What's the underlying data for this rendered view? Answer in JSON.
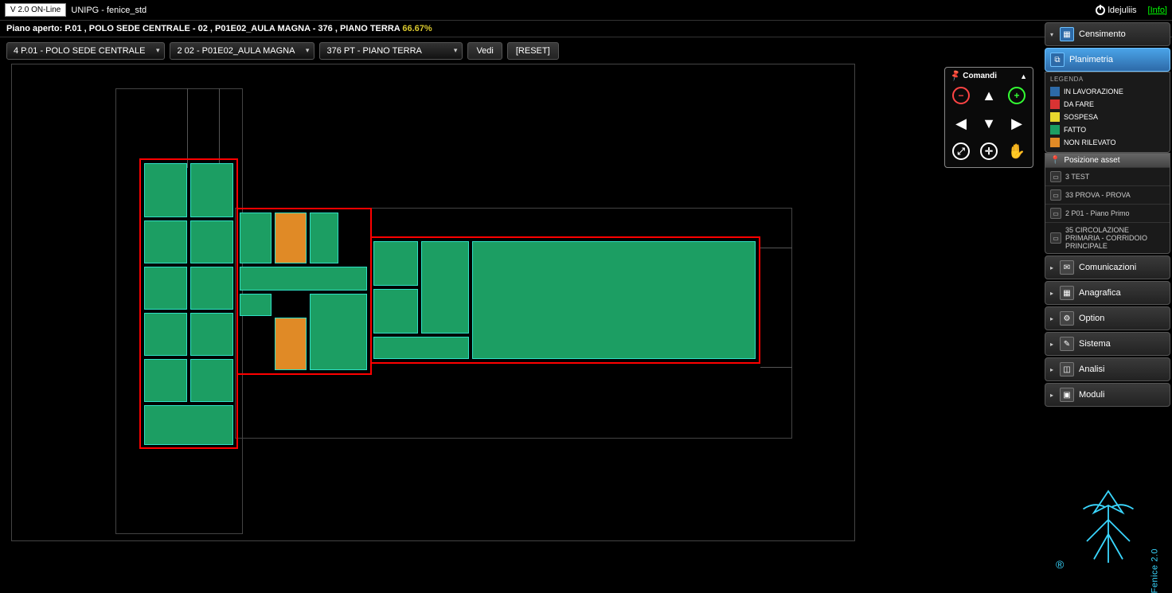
{
  "topbar": {
    "version": "V 2.0 ON-Line",
    "app_title": "UNIPG - fenice_std",
    "user": "ldejuliis",
    "info_link": "[Info]"
  },
  "subheader": {
    "label": "Piano aperto:",
    "path": "P.01 , POLO SEDE CENTRALE - 02 , P01E02_AULA MAGNA - 376 , PIANO TERRA",
    "percent": "66.67%"
  },
  "toolbar": {
    "dd1": "4 P.01 - POLO SEDE CENTRALE",
    "dd2": "2 02 - P01E02_AULA MAGNA",
    "dd3": "376 PT - PIANO TERRA",
    "btn_view": "Vedi",
    "btn_reset": "[RESET]"
  },
  "commands": {
    "header": "Comandi"
  },
  "sidebar": {
    "items": [
      {
        "label": "Censimento"
      },
      {
        "label": "Planimetria"
      },
      {
        "label": "Comunicazioni"
      },
      {
        "label": "Anagrafica"
      },
      {
        "label": "Option"
      },
      {
        "label": "Sistema"
      },
      {
        "label": "Analisi"
      },
      {
        "label": "Moduli"
      }
    ],
    "legend": {
      "title": "LEGENDA",
      "rows": [
        {
          "label": "IN LAVORAZIONE",
          "color": "#2d6aa8"
        },
        {
          "label": "DA FARE",
          "color": "#d93333"
        },
        {
          "label": "SOSPESA",
          "color": "#e8d82e"
        },
        {
          "label": "FATTO",
          "color": "#1c9e63"
        },
        {
          "label": "NON RILEVATO",
          "color": "#e08a26"
        }
      ]
    },
    "assets": {
      "header": "Posizione asset",
      "rows": [
        {
          "label": "3 TEST"
        },
        {
          "label": "33 PROVA - PROVA"
        },
        {
          "label": "2 P01 - Piano Primo"
        },
        {
          "label": "35 CIRCOLAZIONE PRIMARIA - CORRIDOIO PRINCIPALE"
        }
      ]
    }
  },
  "logo": {
    "name": "Fenice 2.0",
    "reg": "®"
  }
}
